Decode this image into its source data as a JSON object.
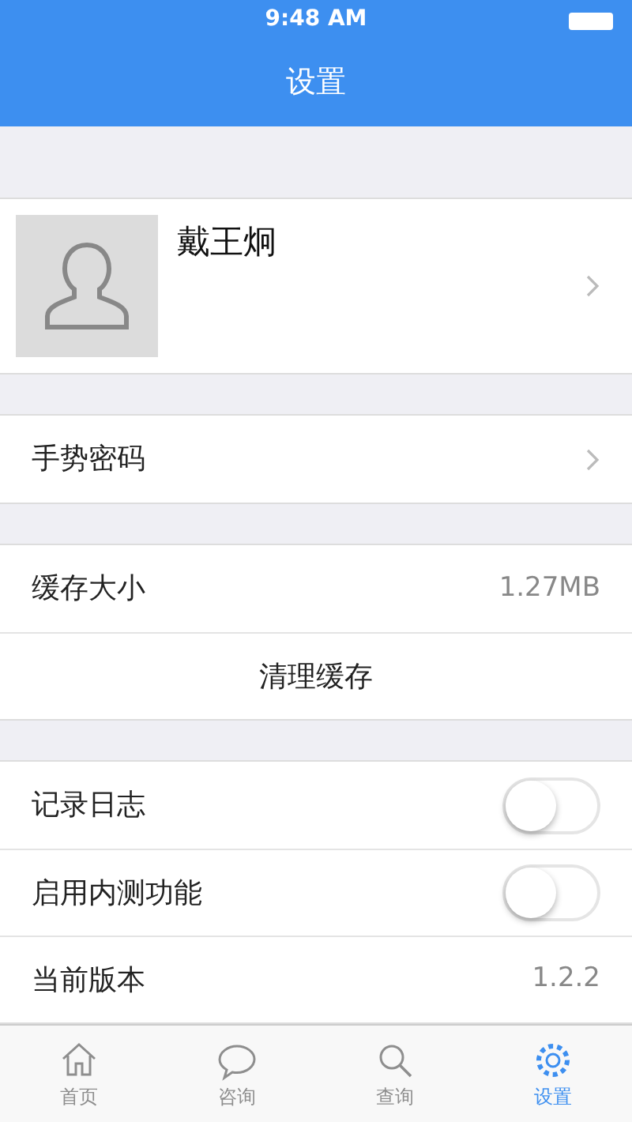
{
  "status_bar": {
    "time": "9:48 AM"
  },
  "nav_bar": {
    "title": "设置"
  },
  "profile": {
    "name": "戴王炯"
  },
  "sections": [
    [
      {
        "kind": "link",
        "label": "手势密码"
      }
    ],
    [
      {
        "kind": "value",
        "label": "缓存大小",
        "value": "1.27MB"
      },
      {
        "kind": "action",
        "label": "清理缓存"
      }
    ],
    [
      {
        "kind": "toggle",
        "label": "记录日志",
        "on": false
      },
      {
        "kind": "toggle",
        "label": "启用内测功能",
        "on": false
      },
      {
        "kind": "value",
        "label": "当前版本",
        "value": "1.2.2"
      }
    ]
  ],
  "tab_bar": [
    {
      "label": "首页",
      "kind": "home",
      "selected": false
    },
    {
      "label": "咨询",
      "kind": "chat",
      "selected": false
    },
    {
      "label": "查询",
      "kind": "search",
      "selected": false
    },
    {
      "label": "设置",
      "kind": "gear",
      "selected": true
    }
  ]
}
